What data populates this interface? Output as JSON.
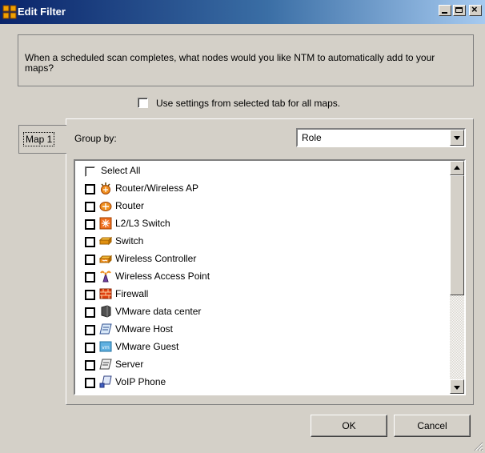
{
  "window": {
    "title": "Edit Filter"
  },
  "prompt": {
    "text": "When a scheduled scan completes, what nodes would you like NTM to automatically add to your maps?"
  },
  "options": {
    "use_settings_label": "Use settings from selected tab for all maps."
  },
  "tabs": [
    {
      "label": "Map 1"
    }
  ],
  "group_by": {
    "label": "Group by:",
    "value": "Role"
  },
  "list": {
    "select_all": "Select All",
    "items": [
      {
        "label": "Router/Wireless AP",
        "icon": "router-wireless-ap-icon"
      },
      {
        "label": "Router",
        "icon": "router-icon"
      },
      {
        "label": "L2/L3 Switch",
        "icon": "l2-l3-switch-icon"
      },
      {
        "label": "Switch",
        "icon": "switch-icon"
      },
      {
        "label": "Wireless Controller",
        "icon": "wireless-controller-icon"
      },
      {
        "label": "Wireless Access Point",
        "icon": "wireless-access-point-icon"
      },
      {
        "label": "Firewall",
        "icon": "firewall-icon"
      },
      {
        "label": "VMware data center",
        "icon": "vmware-data-center-icon"
      },
      {
        "label": "VMware Host",
        "icon": "vmware-host-icon"
      },
      {
        "label": "VMware Guest",
        "icon": "vmware-guest-icon"
      },
      {
        "label": "Server",
        "icon": "server-icon"
      },
      {
        "label": "VoIP Phone",
        "icon": "voip-phone-icon"
      }
    ]
  },
  "buttons": {
    "ok": "OK",
    "cancel": "Cancel"
  }
}
